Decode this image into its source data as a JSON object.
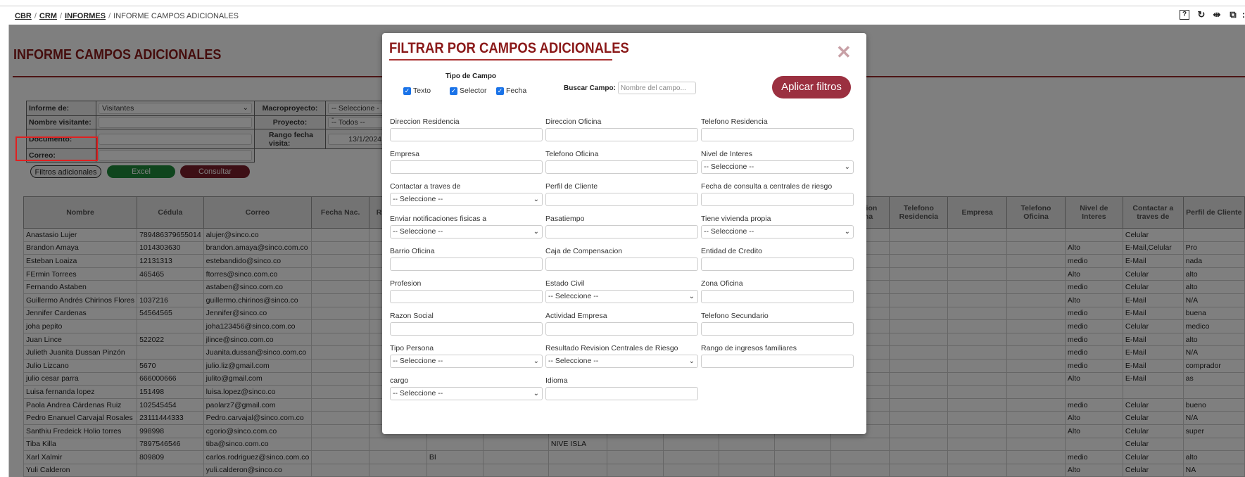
{
  "breadcrumb": {
    "items": [
      "CBR",
      "CRM",
      "INFORMES"
    ],
    "current": "INFORME CAMPOS ADICIONALES"
  },
  "toolbar_icons": [
    "help-icon",
    "refresh-icon",
    "split-icon",
    "window-icon"
  ],
  "page": {
    "title": "INFORME CAMPOS ADICIONALES"
  },
  "filters": {
    "informe_label": "Informe de:",
    "informe_value": "Visitantes",
    "nombre_label": "Nombre visitante:",
    "documento_label": "Documento:",
    "correo_label": "Correo:",
    "macro_label": "Macroproyecto:",
    "macro_value": "-- Seleccione --",
    "proyecto_label": "Proyecto:",
    "proyecto_value": "-- Todos --",
    "rango_label": "Rango fecha visita:",
    "rango_value": "13/1/2024"
  },
  "buttons": {
    "filtros": "Filtros adicionales",
    "excel": "Excel",
    "consultar": "Consultar"
  },
  "colors": {
    "brand": "#8b1a1a",
    "excel": "#1e8a3a",
    "consultar": "#7a1f2b",
    "apply": "#9b3040",
    "highlight": "#e02020"
  },
  "table": {
    "columns": [
      "Nombre",
      "Cédula",
      "Correo",
      "Fecha Nac.",
      "Rango Edad",
      "",
      "",
      "",
      "",
      "",
      "",
      "",
      "Direccion Oficina",
      "Telefono Residencia",
      "Empresa",
      "Telefono Oficina",
      "Nivel de Interes",
      "Contactar a traves de",
      "Perfil de Cliente"
    ],
    "rows": [
      [
        "Anastasio Lujer",
        "789486379655014",
        "alujer@sinco.co",
        "",
        "",
        "",
        "",
        "",
        "",
        "",
        "",
        "",
        "",
        "",
        "",
        "",
        "",
        "Celular",
        ""
      ],
      [
        "Brandon Amaya",
        "1014303630",
        "brandon.amaya@sinco.com.co",
        "",
        "",
        "",
        "",
        "",
        "",
        "",
        "",
        "",
        "",
        "",
        "",
        "",
        "Alto",
        "E-Mail,Celular",
        "Pro"
      ],
      [
        "Esteban Loaiza",
        "12131313",
        "estebandido@sinco.co",
        "",
        "",
        "",
        "",
        "",
        "",
        "",
        "",
        "",
        "",
        "",
        "",
        "",
        "medio",
        "E-Mail",
        "nada"
      ],
      [
        "FErmin Torrees",
        "465465",
        "ftorres@sinco.com.co",
        "",
        "",
        "",
        "",
        "",
        "",
        "",
        "",
        "",
        "",
        "",
        "",
        "",
        "Alto",
        "Celular",
        "alto"
      ],
      [
        "Fernando Astaben",
        "",
        "astaben@sinco.com.co",
        "",
        "",
        "",
        "",
        "",
        "",
        "",
        "",
        "",
        "",
        "",
        "",
        "",
        "medio",
        "Celular",
        "alto"
      ],
      [
        "Guillermo Andrés Chirinos Flores",
        "1037216",
        "guillermo.chirinos@sinco.co",
        "",
        "",
        "",
        "",
        "",
        "",
        "",
        "",
        "",
        "",
        "",
        "",
        "",
        "Alto",
        "E-Mail",
        "N/A"
      ],
      [
        "Jennifer Cardenas",
        "54564565",
        "Jennifer@sinco.co",
        "",
        "",
        "",
        "",
        "",
        "",
        "",
        "",
        "",
        "",
        "",
        "",
        "",
        "medio",
        "E-Mail",
        "buena"
      ],
      [
        "joha pepito",
        "",
        "joha123456@sinco.com.co",
        "",
        "",
        "",
        "",
        "",
        "",
        "",
        "",
        "",
        "",
        "",
        "",
        "",
        "medio",
        "Celular",
        "medico"
      ],
      [
        "Juan Lince",
        "522022",
        "jlince@sinco.com.co",
        "",
        "",
        "",
        "",
        "",
        "",
        "",
        "",
        "",
        "",
        "",
        "",
        "",
        "medio",
        "E-Mail",
        "alto"
      ],
      [
        "Julieth Juanita Dussan Pinzón",
        "",
        "Juanita.dussan@sinco.com.co",
        "",
        "",
        "",
        "",
        "",
        "",
        "",
        "",
        "",
        "",
        "",
        "",
        "",
        "medio",
        "E-Mail",
        "N/A"
      ],
      [
        "Julio Lizcano",
        "5670",
        "julio.liz@gmail.com",
        "",
        "",
        "",
        "",
        "",
        "",
        "",
        "",
        "",
        "",
        "",
        "",
        "",
        "medio",
        "E-Mail",
        "comprador"
      ],
      [
        "julio cesar parra",
        "666000666",
        "julito@gmail.com",
        "",
        "",
        "",
        "",
        "",
        "",
        "",
        "",
        "",
        "",
        "",
        "",
        "",
        "Alto",
        "E-Mail",
        "as"
      ],
      [
        "Luisa fernanda lopez",
        "151498",
        "luisa.lopez@sinco.co",
        "",
        "",
        "",
        "",
        "",
        "",
        "",
        "",
        "",
        "",
        "",
        "",
        "",
        "",
        "",
        ""
      ],
      [
        "Paola Andrea Cárdenas Ruiz",
        "102545454",
        "paolarz7@gmail.com",
        "",
        "",
        "",
        "",
        "",
        "",
        "",
        "",
        "",
        "",
        "",
        "",
        "",
        "medio",
        "Celular",
        "bueno"
      ],
      [
        "Pedro Enanuel Carvajal Rosales",
        "23111444333",
        "Pedro.carvajal@sinco.com.co",
        "",
        "",
        "",
        "",
        "",
        "",
        "",
        "",
        "",
        "",
        "",
        "",
        "",
        "Alto",
        "Celular",
        "N/A"
      ],
      [
        "Santhiu Fredeick Holio torres",
        "998998",
        "cgorio@sinco.com.co",
        "",
        "",
        "",
        "",
        "",
        "",
        "",
        "",
        "",
        "",
        "",
        "",
        "",
        "Alto",
        "Celular",
        "super"
      ],
      [
        "Tiba Killa",
        "7897546546",
        "tiba@sinco.com.co",
        "",
        "",
        "",
        "",
        "NIVE ISLA",
        "",
        "",
        "",
        "",
        "",
        "",
        "",
        "",
        "",
        "Celular",
        ""
      ],
      [
        "Xarl Xalmir",
        "809809",
        "carlos.rodriguez@sinco.com.co",
        "",
        "",
        "BI",
        "",
        "",
        "",
        "",
        "",
        "",
        "",
        "",
        "",
        "",
        "medio",
        "Celular",
        "alto"
      ],
      [
        "Yuli Calderon",
        "",
        "yuli.calderon@sinco.co",
        "",
        "",
        "",
        "",
        "",
        "",
        "",
        "",
        "",
        "",
        "",
        "",
        "",
        "Alto",
        "Celular",
        "NA"
      ]
    ]
  },
  "modal": {
    "title": "FILTRAR POR CAMPOS ADICIONALES",
    "tipo_label": "Tipo de Campo",
    "checkboxes": [
      {
        "label": "Texto",
        "checked": true
      },
      {
        "label": "Selector",
        "checked": true
      },
      {
        "label": "Fecha",
        "checked": true
      }
    ],
    "buscar_label": "Buscar Campo:",
    "buscar_placeholder": "Nombre del campo...",
    "apply_label": "Aplicar filtros",
    "fields": [
      {
        "label": "Direccion Residencia",
        "type": "text"
      },
      {
        "label": "Direccion Oficina",
        "type": "text"
      },
      {
        "label": "Telefono Residencia",
        "type": "text"
      },
      {
        "label": "Empresa",
        "type": "text"
      },
      {
        "label": "Telefono Oficina",
        "type": "text"
      },
      {
        "label": "Nivel de Interes",
        "type": "select",
        "value": "-- Seleccione --"
      },
      {
        "label": "Contactar a traves de",
        "type": "select",
        "value": "-- Seleccione --"
      },
      {
        "label": "Perfil de Cliente",
        "type": "text"
      },
      {
        "label": "Fecha de consulta a centrales de riesgo",
        "type": "text"
      },
      {
        "label": "Enviar notificaciones fisicas a",
        "type": "select",
        "value": "-- Seleccione --"
      },
      {
        "label": "Pasatiempo",
        "type": "text"
      },
      {
        "label": "Tiene vivienda propia",
        "type": "select",
        "value": "-- Seleccione --"
      },
      {
        "label": "Barrio Oficina",
        "type": "text"
      },
      {
        "label": "Caja de Compensacion",
        "type": "text"
      },
      {
        "label": "Entidad de Credito",
        "type": "text"
      },
      {
        "label": "Profesion",
        "type": "text"
      },
      {
        "label": "Estado Civil",
        "type": "select",
        "value": "-- Seleccione --"
      },
      {
        "label": "Zona Oficina",
        "type": "text"
      },
      {
        "label": "Razon Social",
        "type": "text"
      },
      {
        "label": "Actividad Empresa",
        "type": "text"
      },
      {
        "label": "Telefono Secundario",
        "type": "text"
      },
      {
        "label": "Tipo Persona",
        "type": "select",
        "value": "-- Seleccione --"
      },
      {
        "label": "Resultado Revision Centrales de Riesgo",
        "type": "select",
        "value": "-- Seleccione --"
      },
      {
        "label": "Rango de ingresos familiares",
        "type": "text"
      },
      {
        "label": "cargo",
        "type": "select",
        "value": "-- Seleccione --"
      },
      {
        "label": "Idioma",
        "type": "text"
      }
    ]
  }
}
